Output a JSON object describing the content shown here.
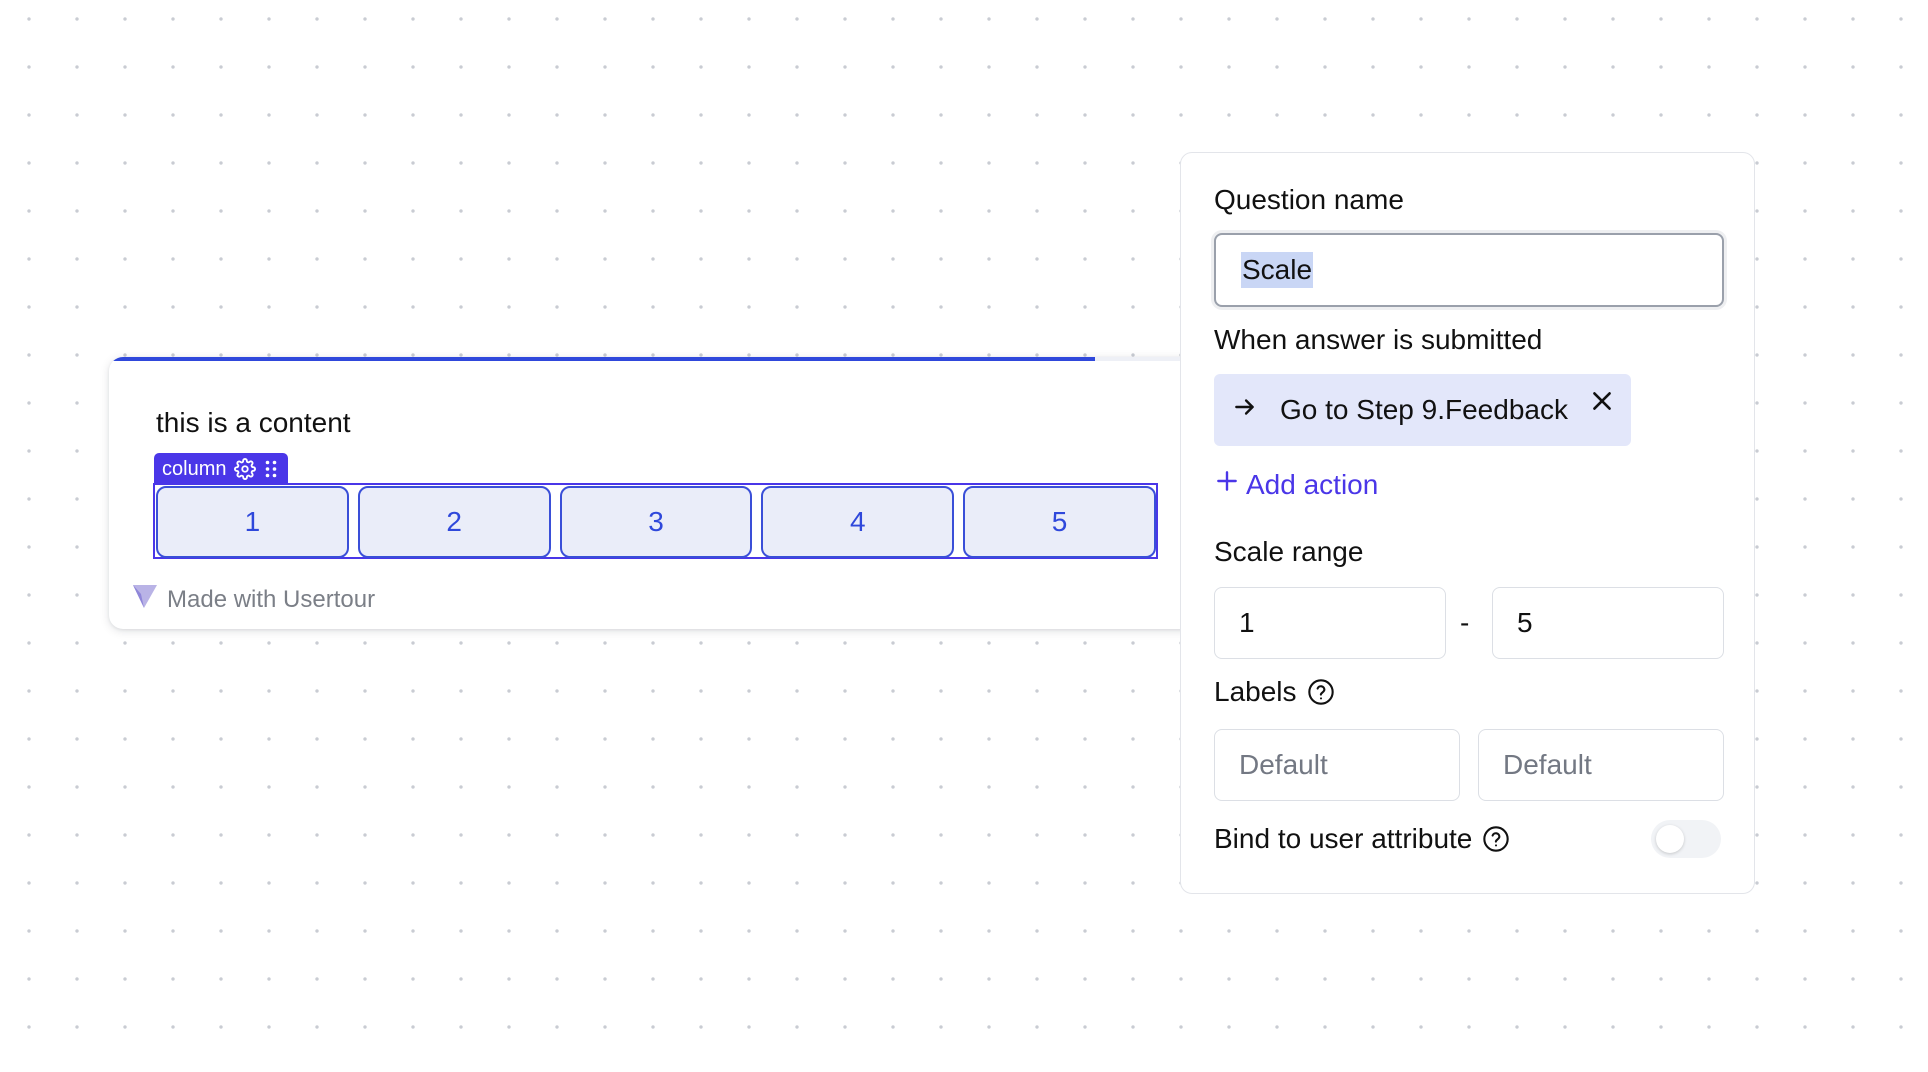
{
  "survey": {
    "progress_percent": 90,
    "content_text": "this is a content",
    "column_tag_label": "column",
    "scale_options": [
      "1",
      "2",
      "3",
      "4",
      "5"
    ],
    "branding": "Made with Usertour"
  },
  "panel": {
    "question_name_label": "Question name",
    "question_name_value": "Scale",
    "submit_label": "When answer is submitted",
    "action_chip": "Go to Step 9.Feedback",
    "add_action": "Add action",
    "scale_range_label": "Scale range",
    "scale_min": "1",
    "range_separator": "-",
    "scale_max": "5",
    "labels_label": "Labels",
    "label_low_placeholder": "Default",
    "label_high_placeholder": "Default",
    "bind_label": "Bind to user attribute",
    "bind_enabled": false
  },
  "colors": {
    "accent": "#4a36e8",
    "scale_blue": "#2f48db",
    "chip_bg": "#e3e7fa"
  },
  "icons": [
    "settings-gear-icon",
    "drag-handle-icon",
    "usertour-logo-icon",
    "arrow-right-icon",
    "close-icon",
    "plus-icon",
    "help-circle-icon"
  ]
}
